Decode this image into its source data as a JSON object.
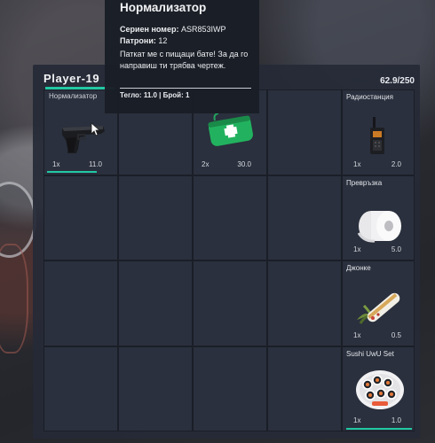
{
  "inventory": {
    "title": "Player-19",
    "weight": "62.9/250",
    "grid": [
      {
        "name": "Нормализатор",
        "qty": "1x",
        "weight": "11.0",
        "icon": "pistol-icon",
        "selected": true
      },
      {
        "name": "",
        "qty": "",
        "weight": "",
        "icon": ""
      },
      {
        "name": "",
        "qty": "2x",
        "weight": "30.0",
        "icon": "first-aid-kit-icon"
      },
      {
        "name": "",
        "qty": "",
        "weight": "",
        "icon": ""
      }
    ],
    "side_slots": [
      {
        "name": "Радиостанция",
        "qty": "1x",
        "weight": "2.0",
        "icon": "radio-icon"
      },
      {
        "name": "Превръзка",
        "qty": "1x",
        "weight": "5.0",
        "icon": "bandage-roll-icon"
      },
      {
        "name": "Джонке",
        "qty": "1x",
        "weight": "0.5",
        "icon": "joint-icon"
      },
      {
        "name": "Sushi UwU Set",
        "qty": "1x",
        "weight": "1.0",
        "icon": "sushi-plate-icon"
      }
    ]
  },
  "tooltip": {
    "title": "Нормализатор",
    "serial_label": "Сериен номер:",
    "serial_value": "ASR853IWP",
    "ammo_label": "Патрони:",
    "ammo_value": "12",
    "description": "Паткат ме с пищаци бате! За да го направиш ти трябва чертеж.",
    "footer": "Тегло: 11.0 | Брой: 1"
  },
  "colors": {
    "accent": "#22c8a4",
    "panel": "#262a37",
    "cell": "#2a303d"
  }
}
